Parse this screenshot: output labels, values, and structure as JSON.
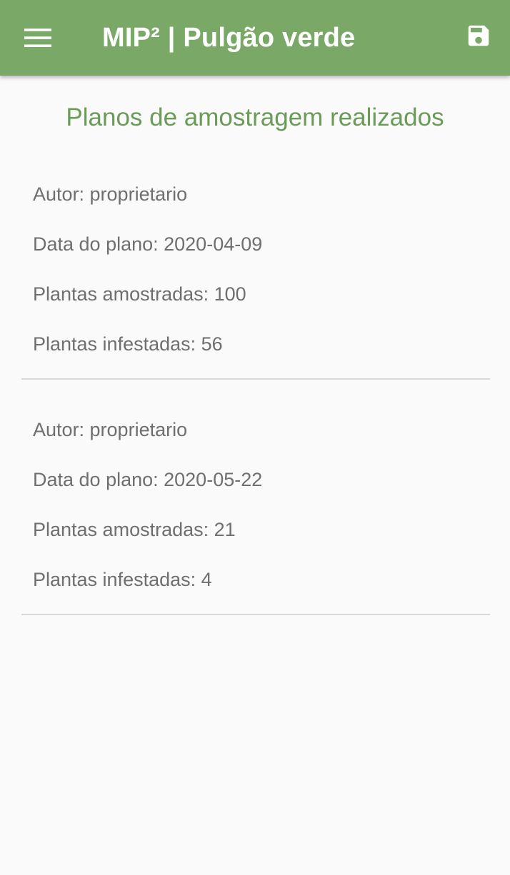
{
  "appbar": {
    "title": "MIP² | Pulgão verde",
    "menu_icon": "hamburger-menu-icon",
    "save_icon": "floppy-disk-icon",
    "color": "#7aa866"
  },
  "page": {
    "heading": "Planos de amostragem realizados",
    "heading_color": "#6a9c58"
  },
  "plans": [
    {
      "autor": "Autor: proprietario",
      "data": "Data do plano: 2020-04-09",
      "amostradas": "Plantas amostradas: 100",
      "infestadas": "Plantas infestadas: 56"
    },
    {
      "autor": "Autor: proprietario",
      "data": "Data do plano: 2020-05-22",
      "amostradas": "Plantas amostradas: 21",
      "infestadas": "Plantas infestadas: 4"
    }
  ]
}
